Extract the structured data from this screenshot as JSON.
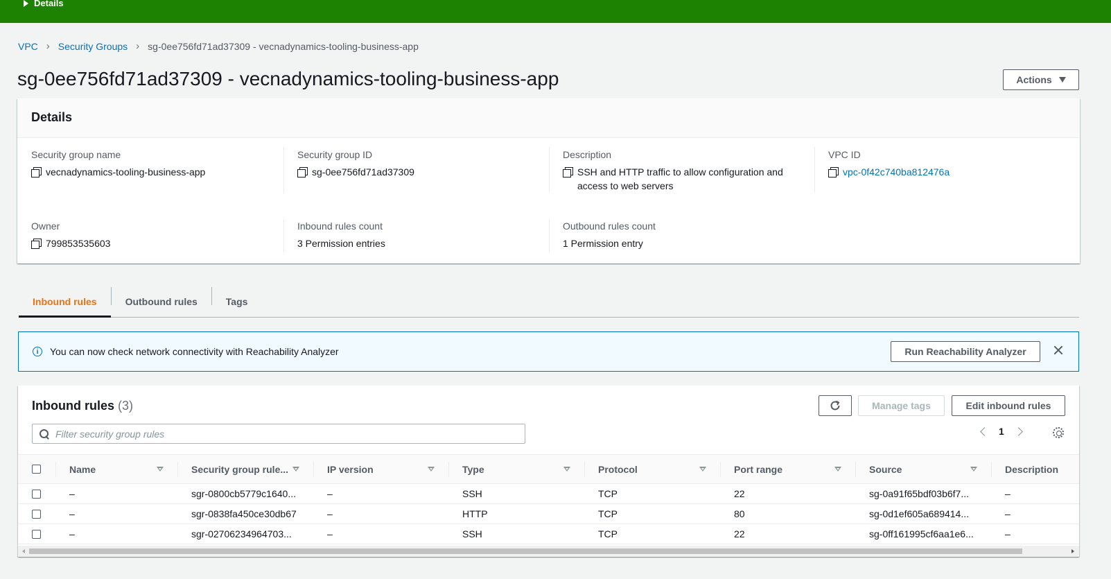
{
  "flash": {
    "label": "Details"
  },
  "breadcrumb": {
    "vpc": "VPC",
    "security_groups": "Security Groups",
    "current": "sg-0ee756fd71ad37309 - vecnadynamics-tooling-business-app"
  },
  "page": {
    "title": "sg-0ee756fd71ad37309 - vecnadynamics-tooling-business-app",
    "actions_label": "Actions"
  },
  "details": {
    "heading": "Details",
    "sg_name": {
      "label": "Security group name",
      "value": "vecnadynamics-tooling-business-app"
    },
    "sg_id": {
      "label": "Security group ID",
      "value": "sg-0ee756fd71ad37309"
    },
    "description": {
      "label": "Description",
      "value": "SSH and HTTP traffic to allow configuration and access to web servers"
    },
    "vpc_id": {
      "label": "VPC ID",
      "value": "vpc-0f42c740ba812476a"
    },
    "owner": {
      "label": "Owner",
      "value": "799853535603"
    },
    "inbound_count": {
      "label": "Inbound rules count",
      "value": "3 Permission entries"
    },
    "outbound_count": {
      "label": "Outbound rules count",
      "value": "1 Permission entry"
    }
  },
  "tabs": [
    "Inbound rules",
    "Outbound rules",
    "Tags"
  ],
  "banner": {
    "text": "You can now check network connectivity with Reachability Analyzer",
    "button": "Run Reachability Analyzer"
  },
  "rules": {
    "title": "Inbound rules",
    "count": "(3)",
    "manage_tags": "Manage tags",
    "edit": "Edit inbound rules",
    "search_placeholder": "Filter security group rules",
    "page": "1",
    "columns": [
      "Name",
      "Security group rule...",
      "IP version",
      "Type",
      "Protocol",
      "Port range",
      "Source",
      "Description"
    ],
    "rows": [
      [
        "–",
        "sgr-0800cb5779c1640...",
        "–",
        "SSH",
        "TCP",
        "22",
        "sg-0a91f65bdf03b6f7...",
        "–"
      ],
      [
        "–",
        "sgr-0838fa450ce30db67",
        "–",
        "HTTP",
        "TCP",
        "80",
        "sg-0d1ef605a689414...",
        "–"
      ],
      [
        "–",
        "sgr-02706234964703...",
        "–",
        "SSH",
        "TCP",
        "22",
        "sg-0ff161995cf6aa1e6...",
        "–"
      ]
    ]
  },
  "colors": {
    "flash": "#1d8102",
    "link": "#0073bb",
    "active_tab": "#ec7211",
    "banner_bg": "#f1faff"
  }
}
